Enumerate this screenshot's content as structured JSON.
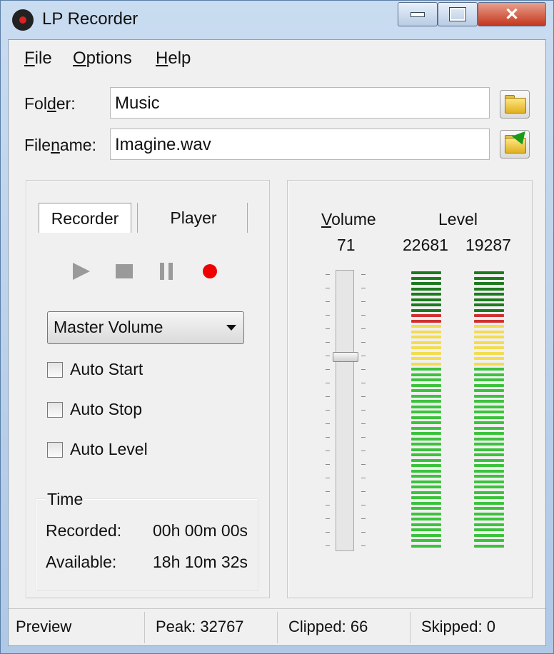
{
  "window": {
    "title": "LP Recorder"
  },
  "menu": [
    {
      "pre": "",
      "accel": "F",
      "post": "ile"
    },
    {
      "pre": "",
      "accel": "O",
      "post": "ptions"
    },
    {
      "pre": "",
      "accel": "H",
      "post": "elp"
    }
  ],
  "folder": {
    "label_pre": "Fol",
    "label_accel": "d",
    "label_post": "er:",
    "value": "Music"
  },
  "filename": {
    "label_pre": "File",
    "label_accel": "n",
    "label_post": "ame:",
    "value": "Imagine.wav"
  },
  "tabs": {
    "recorder": "Recorder",
    "player": "Player"
  },
  "source": {
    "selected": "Master Volume"
  },
  "options": {
    "auto_start": "Auto Start",
    "auto_stop": "Auto Stop",
    "auto_level": "Auto Level"
  },
  "time": {
    "heading": "Time",
    "recorded_label": "Recorded:",
    "recorded_value": "00h 00m 00s",
    "available_label": "Available:",
    "available_value": "18h 10m 32s"
  },
  "volume": {
    "label_accel": "V",
    "label_rest": "olume",
    "value": "71",
    "level": 0.71
  },
  "level": {
    "label": "Level",
    "left": "22681",
    "right": "19287"
  },
  "colors": {
    "dark_green": "#1e7a1e",
    "red": "#d03030",
    "yellow": "#f2dc50",
    "green": "#3cc23c"
  },
  "status": {
    "mode": "Preview",
    "peak": "Peak: 32767",
    "clipped": "Clipped: 66",
    "skipped": "Skipped: 0"
  }
}
